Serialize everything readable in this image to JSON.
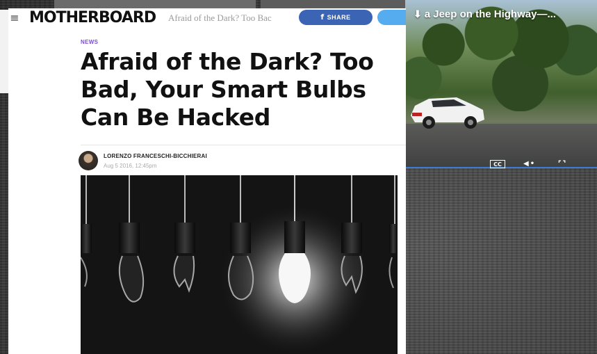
{
  "article": {
    "site_name": "MOTHERBOARD",
    "topbar_title": "Afraid of the Dark? Too Bac",
    "share_label": "SHARE",
    "kicker": "NEWS",
    "headline": "Afraid of the Dark? Too Bad, Your Smart Bulbs Can Be Hacked",
    "author": "LORENZO FRANCESCHI-BICCHIERAI",
    "date": "Aug 5 2016, 12:45pm"
  },
  "video": {
    "title": "a Jeep on the Highway—...",
    "controls": {
      "cc_label": "CC"
    }
  },
  "icons": {
    "menu": "hamburger-icon",
    "facebook": "facebook-icon",
    "download": "download-icon",
    "volume": "volume-icon",
    "fullscreen": "fullscreen-icon"
  },
  "colors": {
    "share_button": "#3b64b4",
    "tweet_button": "#55acee",
    "kicker": "#7a4fd0",
    "progress_bar": "#3b7bd6"
  }
}
